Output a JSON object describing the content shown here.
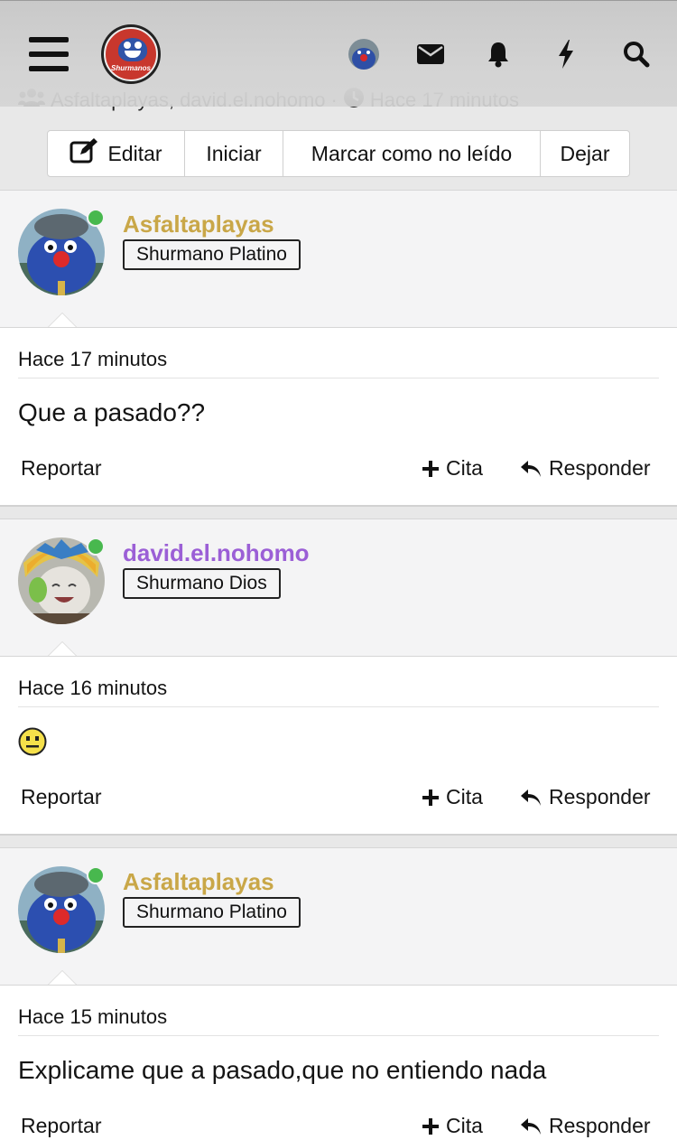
{
  "header": {
    "menu_icon": "hamburger-menu-icon",
    "logo_text": "Shurmanos",
    "icons": [
      "user-avatar-icon",
      "envelope-icon",
      "bell-icon",
      "bolt-icon",
      "search-icon"
    ]
  },
  "thread": {
    "participants": "Asfaltaplayas, david.el.nohomo",
    "separator": "·",
    "time": "Hace 17 minutos"
  },
  "actions": {
    "edit": "Editar",
    "start": "Iniciar",
    "mark_unread": "Marcar como no leído",
    "leave": "Dejar"
  },
  "posts": [
    {
      "username": "Asfaltaplayas",
      "username_color": "#c9a748",
      "rank": "Shurmano Platino",
      "time": "Hace 17 minutos",
      "content": "Que a pasado??",
      "report": "Reportar",
      "quote": "Cita",
      "reply": "Responder"
    },
    {
      "username": "david.el.nohomo",
      "username_color": "#9b5fd6",
      "rank": "Shurmano Dios",
      "time": "Hace 16 minutos",
      "content": "",
      "content_icon": "neutral-face-emoji",
      "report": "Reportar",
      "quote": "Cita",
      "reply": "Responder"
    },
    {
      "username": "Asfaltaplayas",
      "username_color": "#c9a748",
      "rank": "Shurmano Platino",
      "time": "Hace 15 minutos",
      "content": "Explicame que a pasado,que no entiendo nada",
      "report": "Reportar",
      "quote": "Cita",
      "reply": "Responder"
    }
  ]
}
